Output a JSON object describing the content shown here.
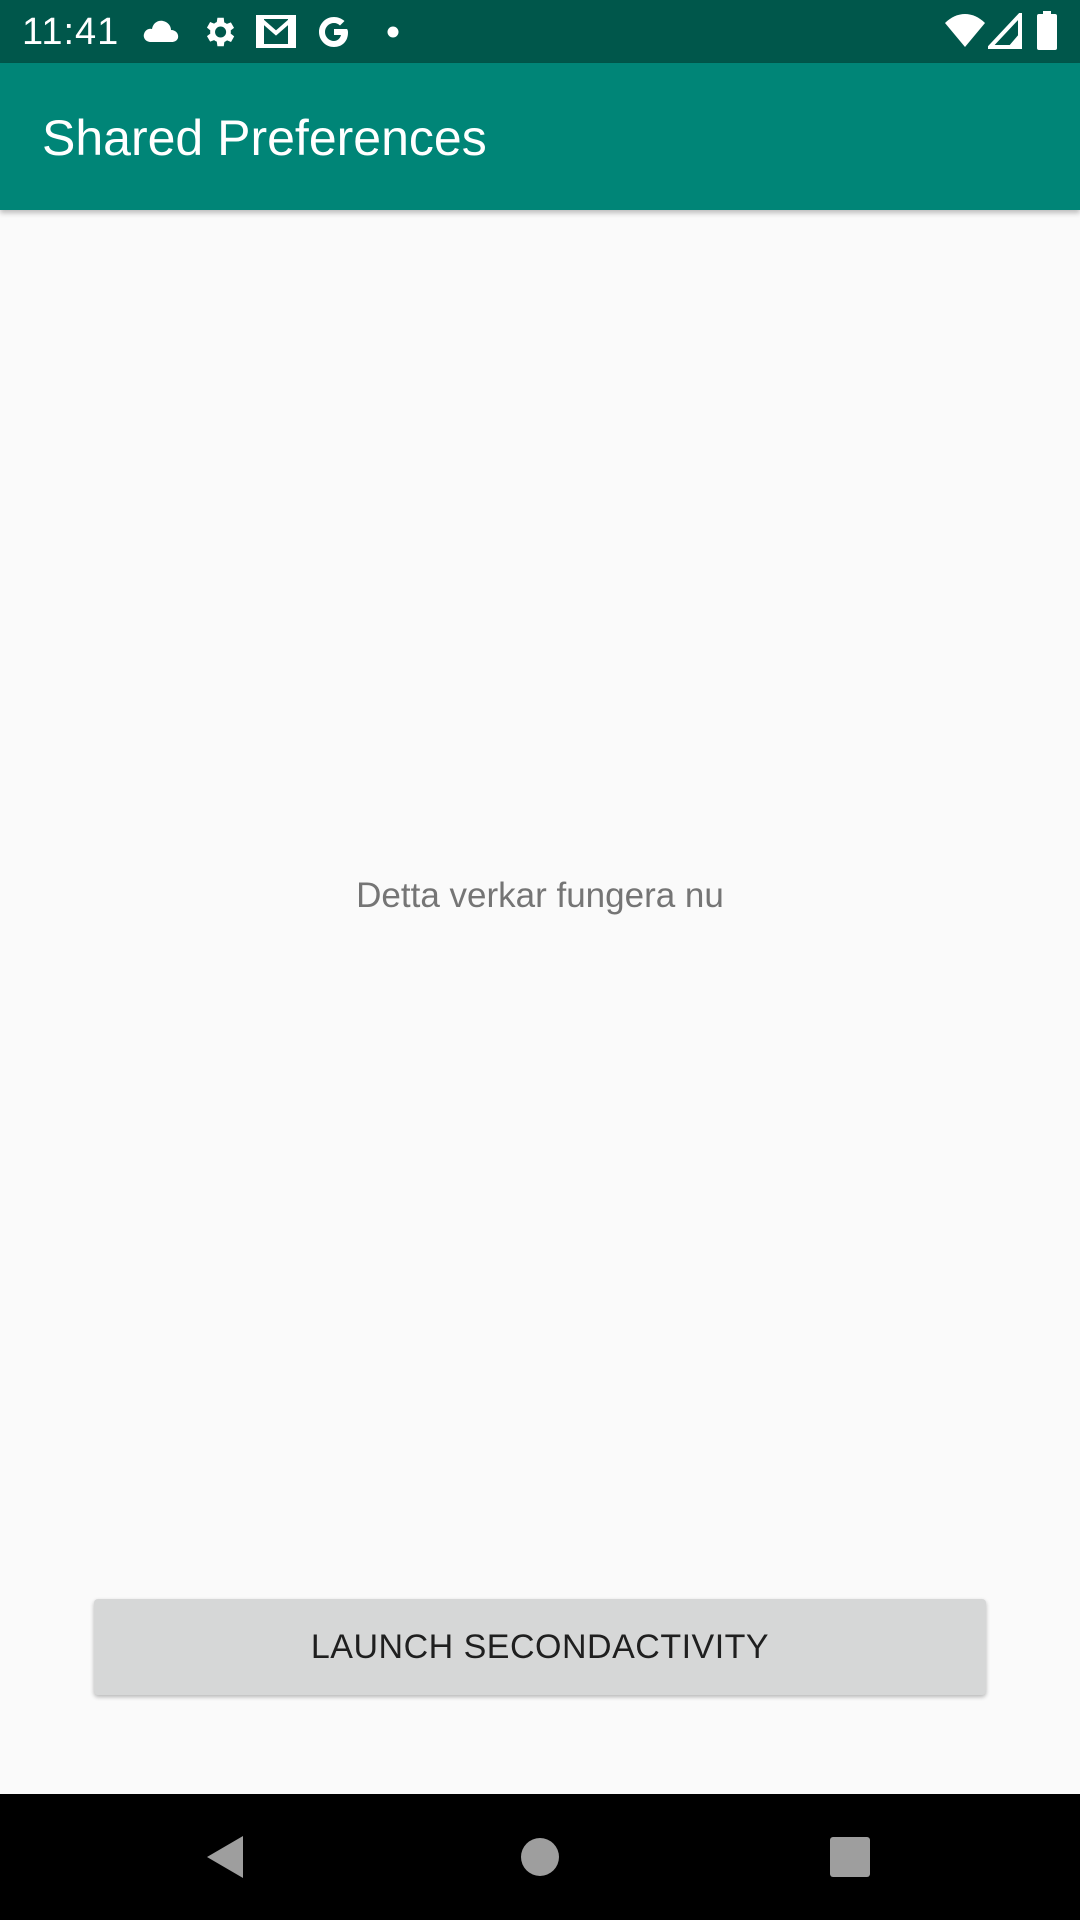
{
  "status_bar": {
    "time": "11:41",
    "background": "#00574b",
    "left_icons": [
      "cloud-icon",
      "settings-gear-icon",
      "gmail-icon",
      "google-g-icon",
      "notification-dot-icon"
    ],
    "right_icons": [
      "wifi-icon",
      "cell-signal-icon",
      "battery-icon"
    ]
  },
  "app_bar": {
    "title": "Shared Preferences",
    "background": "#008577"
  },
  "main": {
    "message": "Detta verkar fungera nu",
    "launch_button_label": "LAUNCH SECONDACTIVITY"
  },
  "nav_bar": {
    "buttons": [
      "back-icon",
      "home-icon",
      "recents-icon"
    ]
  }
}
